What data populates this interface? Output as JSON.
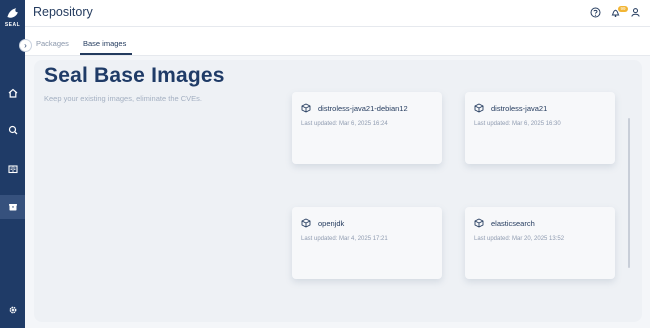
{
  "brand": {
    "logo_text": "SEAL"
  },
  "header": {
    "title": "Repository",
    "notification_count": "99"
  },
  "tabs": [
    {
      "label": "Packages",
      "active": false
    },
    {
      "label": "Base images",
      "active": true
    }
  ],
  "sidebar": {
    "items": [
      {
        "icon": "home-icon",
        "active": false
      },
      {
        "icon": "search-icon",
        "active": false
      },
      {
        "icon": "book-icon",
        "active": false
      },
      {
        "icon": "box-icon",
        "active": true
      }
    ],
    "bottom_icon": "gear-icon"
  },
  "hero": {
    "title": "Seal Base Images",
    "subtitle": "Keep your existing images, eliminate the CVEs."
  },
  "images": [
    {
      "name": "distroless-java21-debian12",
      "updated": "Last updated: Mar 6, 2025 16:24"
    },
    {
      "name": "distroless-java21",
      "updated": "Last updated: Mar 6, 2025 16:30"
    },
    {
      "name": "openjdk",
      "updated": "Last updated: Mar 4, 2025 17:21"
    },
    {
      "name": "elasticsearch",
      "updated": "Last updated: Mar 20, 2025 13:52"
    }
  ],
  "colors": {
    "sidebar": "#1f3b67",
    "accent": "#253c5f",
    "badge": "#f2b534"
  }
}
